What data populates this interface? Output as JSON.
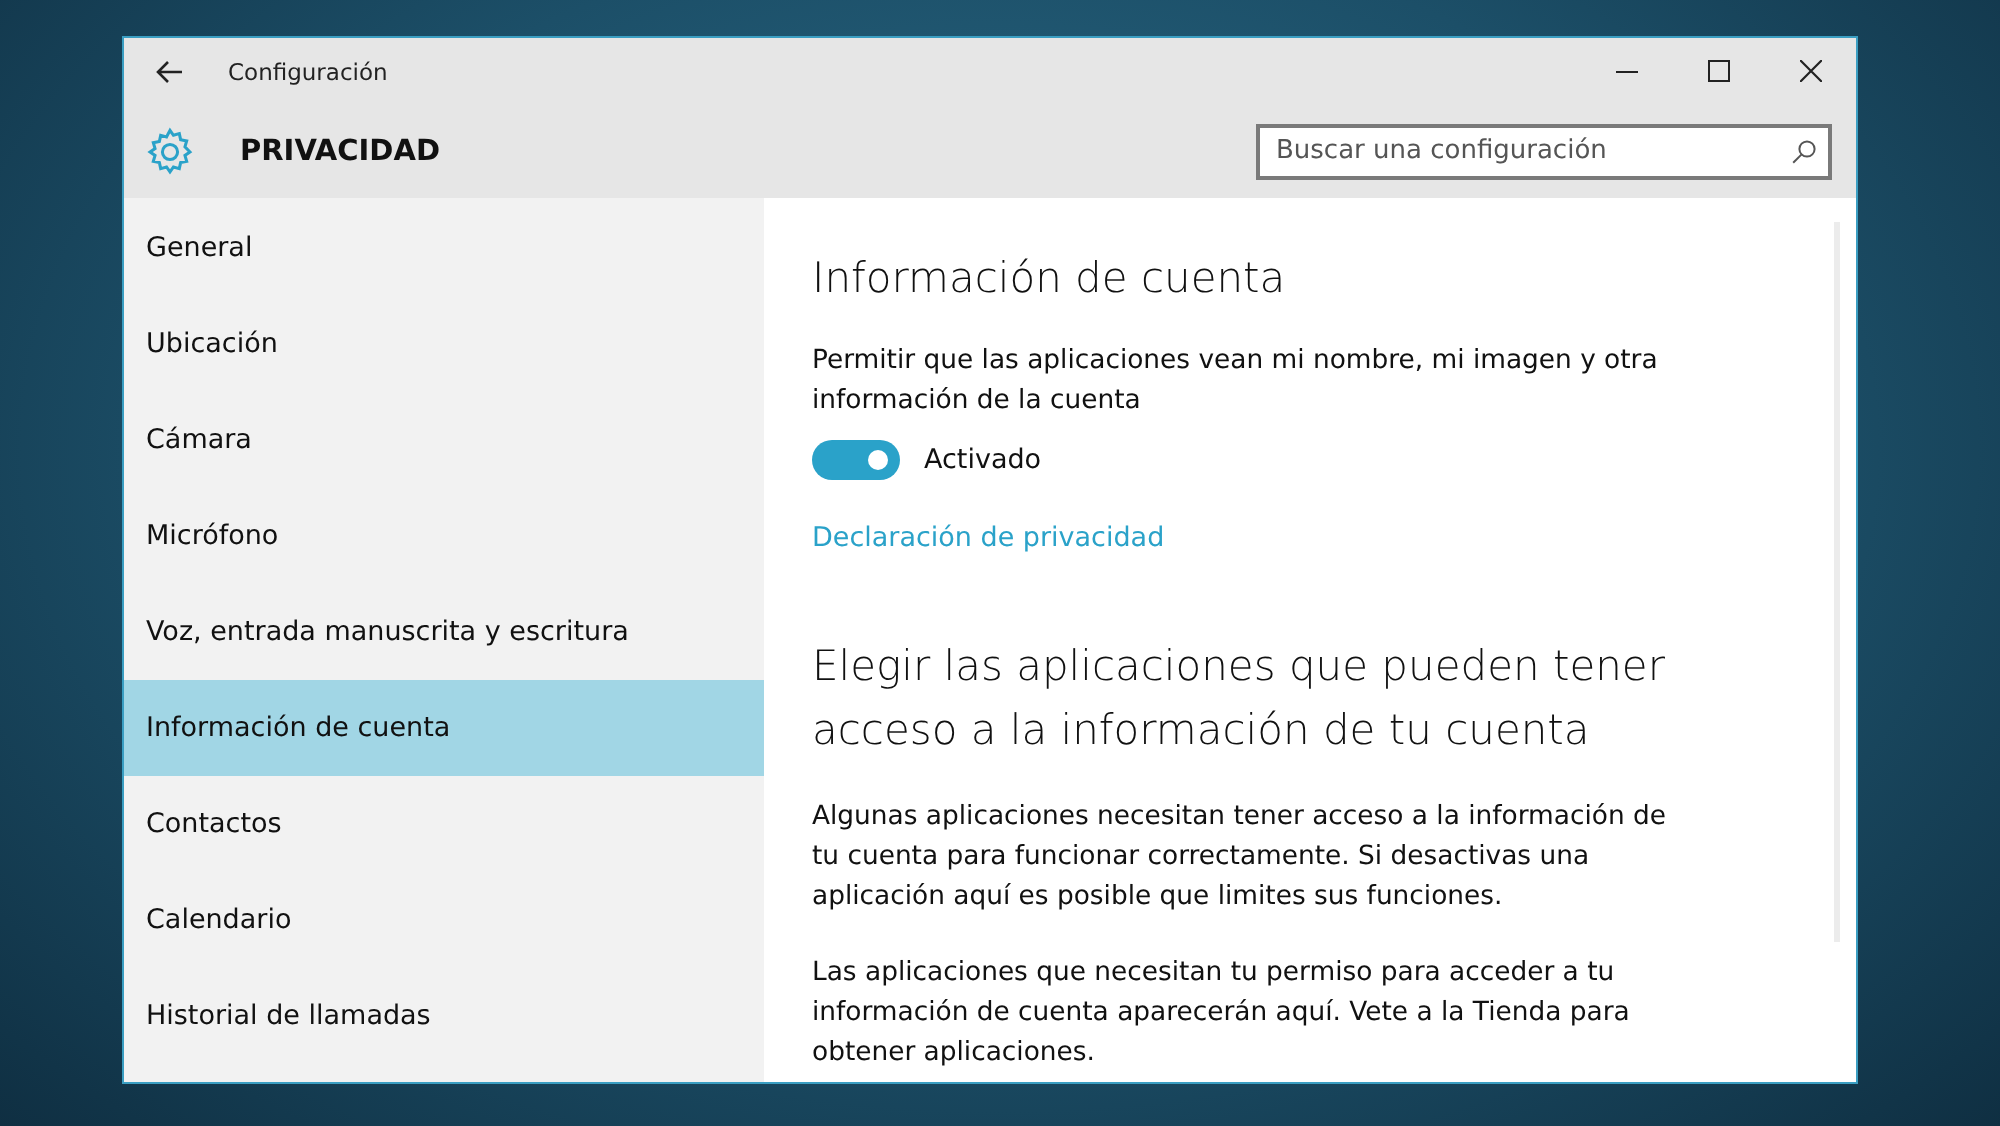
{
  "window": {
    "title": "Configuración"
  },
  "header": {
    "title": "PRIVACIDAD",
    "search": {
      "placeholder": "Buscar una configuración"
    }
  },
  "sidebar": {
    "items": [
      {
        "label": "General",
        "selected": false
      },
      {
        "label": "Ubicación",
        "selected": false
      },
      {
        "label": "Cámara",
        "selected": false
      },
      {
        "label": "Micrófono",
        "selected": false
      },
      {
        "label": "Voz, entrada manuscrita y escritura",
        "selected": false
      },
      {
        "label": "Información de cuenta",
        "selected": true
      },
      {
        "label": "Contactos",
        "selected": false
      },
      {
        "label": "Calendario",
        "selected": false
      },
      {
        "label": "Historial de llamadas",
        "selected": false
      }
    ]
  },
  "content": {
    "section_title": "Información de cuenta",
    "description": "Permitir que las aplicaciones vean mi nombre, mi imagen y otra información de la cuenta",
    "toggle": {
      "on": true,
      "label": "Activado"
    },
    "link": "Declaración de privacidad",
    "apps_title": "Elegir las aplicaciones que pueden tener acceso a la información de tu cuenta",
    "paragraphs": [
      "Algunas aplicaciones necesitan tener acceso a la información de tu cuenta para funcionar correctamente. Si desactivas una aplicación aquí es posible que limites sus funciones.",
      "Las aplicaciones que necesitan tu permiso para acceder a tu información de cuenta aparecerán aquí. Vete a la Tienda para obtener aplicaciones."
    ]
  }
}
